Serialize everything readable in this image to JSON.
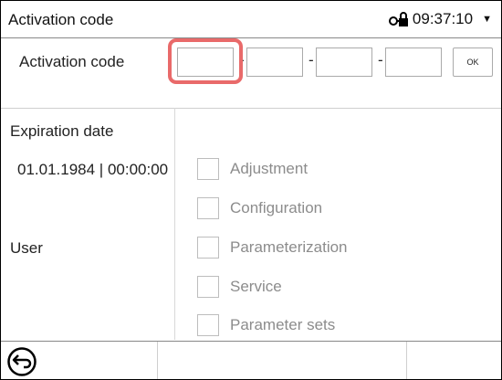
{
  "header": {
    "title": "Activation code",
    "time": "09:37:10",
    "lock_icon": "lock-icon",
    "menu_icon": "caret-down-icon"
  },
  "activation": {
    "label": "Activation code",
    "fields": [
      "",
      "",
      "",
      ""
    ],
    "separator": "-",
    "ok_label": "OK"
  },
  "left": {
    "expiration_label": "Expiration date",
    "expiration_value": "01.01.1984 | 00:00:00",
    "user_label": "User"
  },
  "permissions": [
    {
      "label": "Adjustment",
      "checked": false
    },
    {
      "label": "Configuration",
      "checked": false
    },
    {
      "label": "Parameterization",
      "checked": false
    },
    {
      "label": "Service",
      "checked": false
    },
    {
      "label": "Parameter sets",
      "checked": false
    }
  ],
  "footer": {
    "back_icon": "back-arrow-icon"
  },
  "colors": {
    "highlight": "#e96a6a",
    "disabled_text": "#8c8c8c"
  }
}
